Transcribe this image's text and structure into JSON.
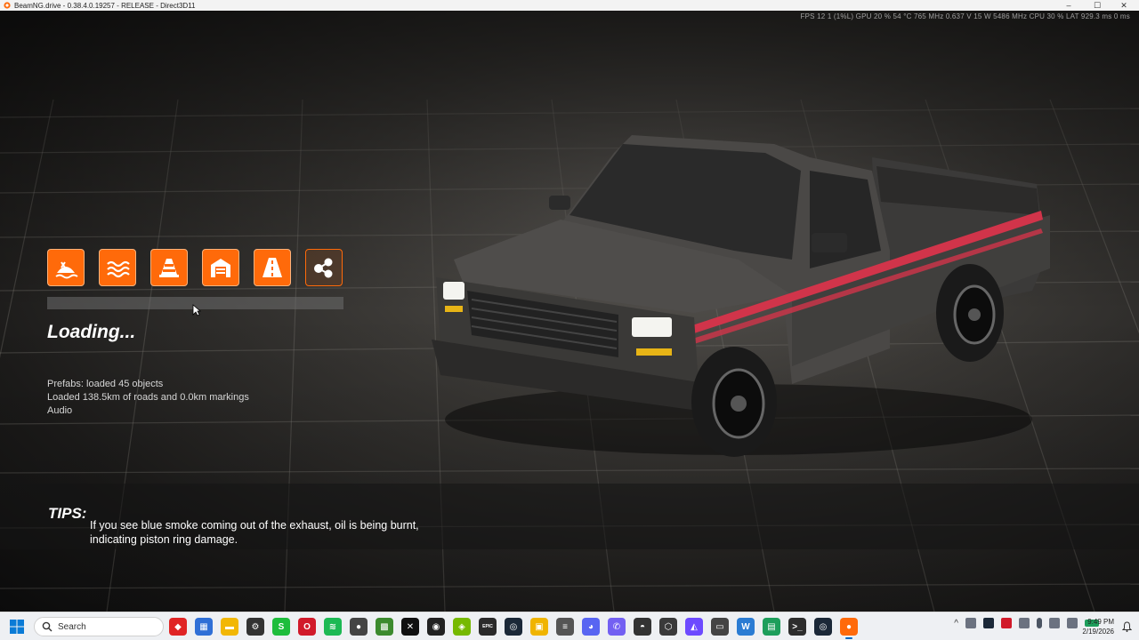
{
  "window": {
    "title": "BeamNG.drive - 0.38.4.0.19257 - RELEASE - Direct3D11",
    "controls": [
      "–",
      "☐",
      "✕"
    ]
  },
  "overlay": {
    "stats": "FPS  12   1 (1%L)    GPU 20 %  54 °C  765 MHz  0.637 V  15 W  5486 MHz    CPU 30 %    LAT 929.3 ms  0 ms"
  },
  "level_icons": [
    {
      "icon": "island-icon",
      "style": "filled"
    },
    {
      "icon": "water-waves-icon",
      "style": "filled"
    },
    {
      "icon": "traffic-cone-icon",
      "style": "filled"
    },
    {
      "icon": "garage-icon",
      "style": "filled"
    },
    {
      "icon": "road-icon",
      "style": "filled"
    },
    {
      "icon": "nodes-share-icon",
      "style": "outline"
    }
  ],
  "loading": {
    "title": "Loading...",
    "progress": 0.0,
    "log": [
      "Prefabs: loaded 45 objects",
      "Loaded 138.5km of roads and 0.0km markings",
      "Audio"
    ]
  },
  "tips": {
    "label": "TIPS:",
    "text": "If you see blue smoke coming out of the exhaust, oil is being burnt, indicating piston ring damage."
  },
  "taskbar": {
    "search_placeholder": "Search",
    "apps": [
      {
        "name": "red-diamond-app-icon",
        "color": "#e02424",
        "glyph": "◆"
      },
      {
        "name": "microsoft-store-icon",
        "color": "#2f6fd6",
        "glyph": "▦"
      },
      {
        "name": "file-explorer-icon",
        "color": "#f2b705",
        "glyph": "▬"
      },
      {
        "name": "steelseries-icon",
        "color": "#333333",
        "glyph": "⚙"
      },
      {
        "name": "razer-icon",
        "color": "#1ebd3c",
        "glyph": "S"
      },
      {
        "name": "opera-gx-icon",
        "color": "#d11a2a",
        "glyph": "O"
      },
      {
        "name": "spotify-icon",
        "color": "#1db954",
        "glyph": "≋"
      },
      {
        "name": "obs-icon",
        "color": "#444444",
        "glyph": "●"
      },
      {
        "name": "minecraft-icon",
        "color": "#3c8a2e",
        "glyph": "▩"
      },
      {
        "name": "capcut-icon",
        "color": "#111111",
        "glyph": "✕"
      },
      {
        "name": "github-icon",
        "color": "#222222",
        "glyph": "◉"
      },
      {
        "name": "nvidia-icon",
        "color": "#76b900",
        "glyph": "◈"
      },
      {
        "name": "epic-games-icon",
        "color": "#2a2a2a",
        "glyph": "EPIC"
      },
      {
        "name": "steam-icon",
        "color": "#1b2838",
        "glyph": "◎"
      },
      {
        "name": "pictures-app-icon",
        "color": "#f0b400",
        "glyph": "▣"
      },
      {
        "name": "stackoverflow-icon",
        "color": "#555555",
        "glyph": "≡"
      },
      {
        "name": "discord-icon",
        "color": "#5865f2",
        "glyph": "◕"
      },
      {
        "name": "viber-icon",
        "color": "#7360f2",
        "glyph": "✆"
      },
      {
        "name": "game-controller-icon",
        "color": "#333333",
        "glyph": "◓"
      },
      {
        "name": "3d-cube-icon",
        "color": "#3a3a3a",
        "glyph": "⬡"
      },
      {
        "name": "proton-vpn-icon",
        "color": "#6d4aff",
        "glyph": "◭"
      },
      {
        "name": "steam-vr-icon",
        "color": "#444444",
        "glyph": "▭"
      },
      {
        "name": "word-app-icon",
        "color": "#2b7cd3",
        "glyph": "W"
      },
      {
        "name": "excel-app-icon",
        "color": "#1d9e5b",
        "glyph": "▤"
      },
      {
        "name": "terminal-icon",
        "color": "#2d2d2d",
        "glyph": ">_"
      },
      {
        "name": "steam-big-icon",
        "color": "#1b2838",
        "glyph": "◎"
      },
      {
        "name": "beamng-icon",
        "color": "#ff6a0a",
        "glyph": "●",
        "active": true
      }
    ],
    "clock_time": "9:49 PM",
    "clock_date": "2/19/2026"
  }
}
